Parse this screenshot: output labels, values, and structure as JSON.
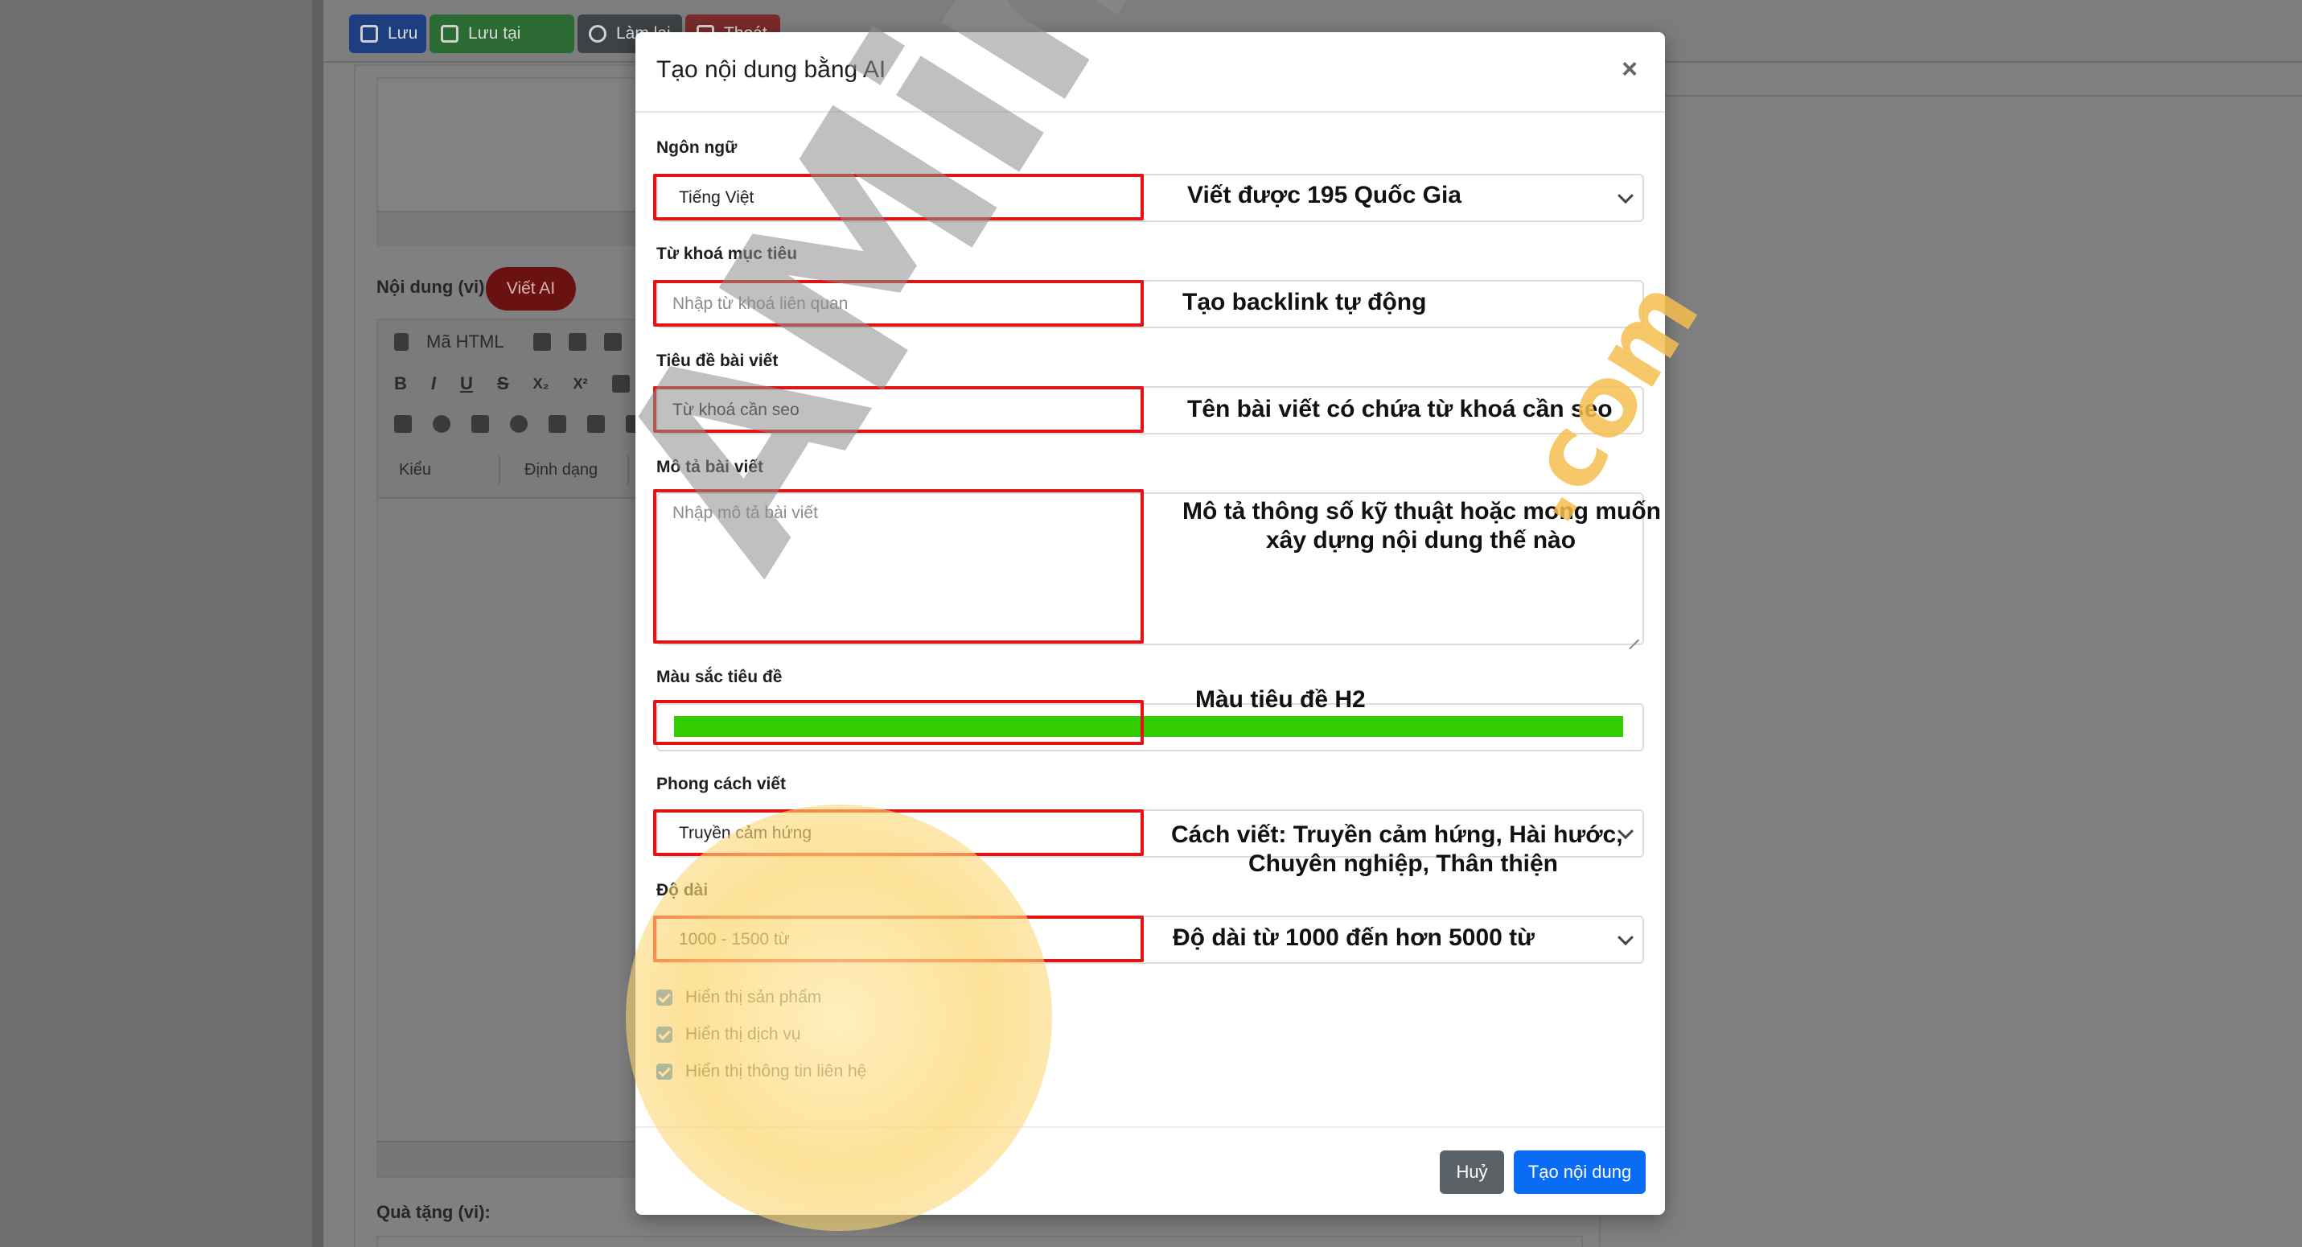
{
  "background": {
    "toolbar": {
      "save": "Lưu",
      "save_stay": "Lưu tại trang",
      "reload": "Làm lại",
      "exit": "Thoát"
    },
    "content_label": "Nội dung (vi):",
    "ai_button": "Viết AI",
    "editor": {
      "html_button": "Mã HTML",
      "style_select": "Kiểu",
      "format_select": "Định dạng",
      "tools_row2": [
        "B",
        "I",
        "U",
        "S",
        "X₂",
        "X²"
      ]
    },
    "gift_label": "Quà tặng (vi):"
  },
  "modal": {
    "title": "Tạo nội dung bằng AI",
    "close": "×",
    "fields": {
      "language": {
        "label": "Ngôn ngữ",
        "value": "Tiếng Việt"
      },
      "keyword": {
        "label": "Từ khoá mục tiêu",
        "placeholder": "Nhập từ khoá liên quan"
      },
      "title": {
        "label": "Tiêu đề bài viết",
        "value": "Từ khoá cần seo"
      },
      "description": {
        "label": "Mô tả bài viết",
        "placeholder": "Nhập mô tả bài viết"
      },
      "heading_color": {
        "label": "Màu sắc tiêu đề",
        "value": "#33cc00"
      },
      "style": {
        "label": "Phong cách viết",
        "value": "Truyền cảm hứng"
      },
      "length": {
        "label": "Độ dài",
        "value": "1000 - 1500 từ"
      }
    },
    "checkboxes": [
      {
        "label": "Hiển thị sản phẩm",
        "checked": true
      },
      {
        "label": "Hiển thị dịch vụ",
        "checked": true
      },
      {
        "label": "Hiển thị thông tin liên hệ",
        "checked": true
      }
    ],
    "buttons": {
      "cancel": "Huỷ",
      "create": "Tạo nội dung"
    }
  },
  "annotations": {
    "language": "Viết được 195 Quốc Gia",
    "keyword": "Tạo backlink tự động",
    "title": "Tên bài viết có chứa từ khoá cần seo",
    "description_line1": "Mô tả thông số kỹ thuật hoặc mong muốn",
    "description_line2": "xây dựng nội dung thế nào",
    "heading_color": "Màu tiêu đề H2",
    "style_line1": "Cách viết: Truyền cảm hứng, Hài hước,",
    "style_line2": "Chuyên nghiệp, Thân thiện",
    "length": "Độ dài từ 1000 đến hơn 5000 từ"
  },
  "watermark": {
    "brand": "AMinhđịnh",
    "suffix": ".com"
  },
  "colors": {
    "annotation_border": "#e11414",
    "primary": "#0a6cf5",
    "secondary": "#5a6268",
    "checkbox": "#1a73e8",
    "heading_color_swatch": "#33cc00"
  }
}
